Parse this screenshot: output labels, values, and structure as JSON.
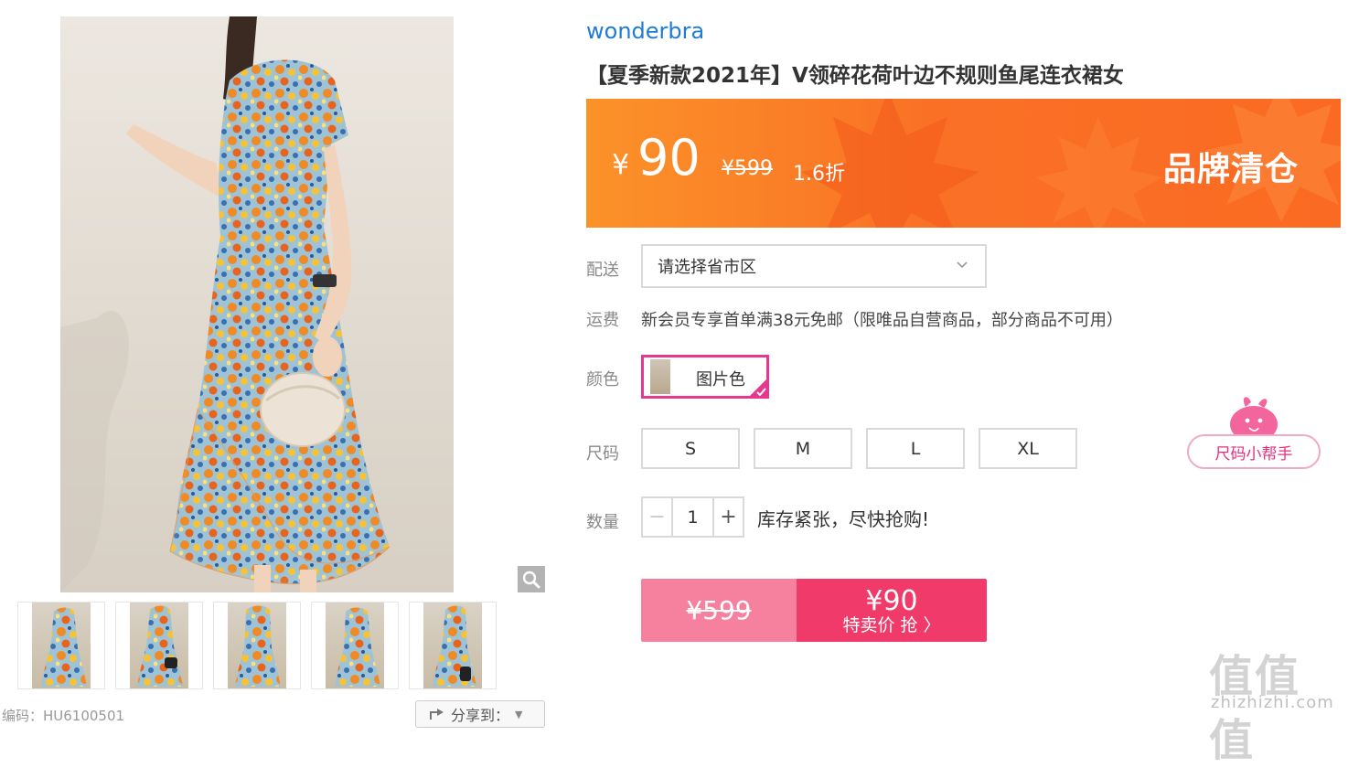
{
  "product": {
    "brand": "wonderbra",
    "title": "【夏季新款2021年】V领碎花荷叶边不规则鱼尾连衣裙女"
  },
  "price_banner": {
    "currency": "¥",
    "price": "90",
    "original_price": "¥599",
    "discount": "1.6折",
    "tag": "品牌清仓",
    "gradient_start": "#fb9228",
    "gradient_end": "#fb6a22"
  },
  "delivery": {
    "label": "配送",
    "placeholder": "请选择省市区"
  },
  "shipping": {
    "label": "运费",
    "text": "新会员专享首单满38元免邮（限唯品自营商品，部分商品不可用）"
  },
  "color": {
    "label": "颜色",
    "options": [
      {
        "label": "图片色",
        "selected": true
      }
    ],
    "accent": "#e5388e"
  },
  "size": {
    "label": "尺码",
    "options": [
      "S",
      "M",
      "L",
      "XL"
    ],
    "helper": "尺码小帮手"
  },
  "quantity": {
    "label": "数量",
    "value": "1",
    "minus": "−",
    "plus": "+",
    "stock_note": "库存紧张，尽快抢购!"
  },
  "buy": {
    "original_price": "¥599",
    "price": "¥90",
    "cta": "特卖价 抢 〉",
    "left_color": "#f5819f",
    "right_color": "#ef3a6a"
  },
  "gallery": {
    "thumbnail_count": 5,
    "zoom_icon": "magnifier-icon",
    "sku_label": "编码：HU6100501",
    "share_label": "分享到："
  },
  "watermark": {
    "glyphs": "值值值",
    "site": "zhizhizhi.com"
  }
}
